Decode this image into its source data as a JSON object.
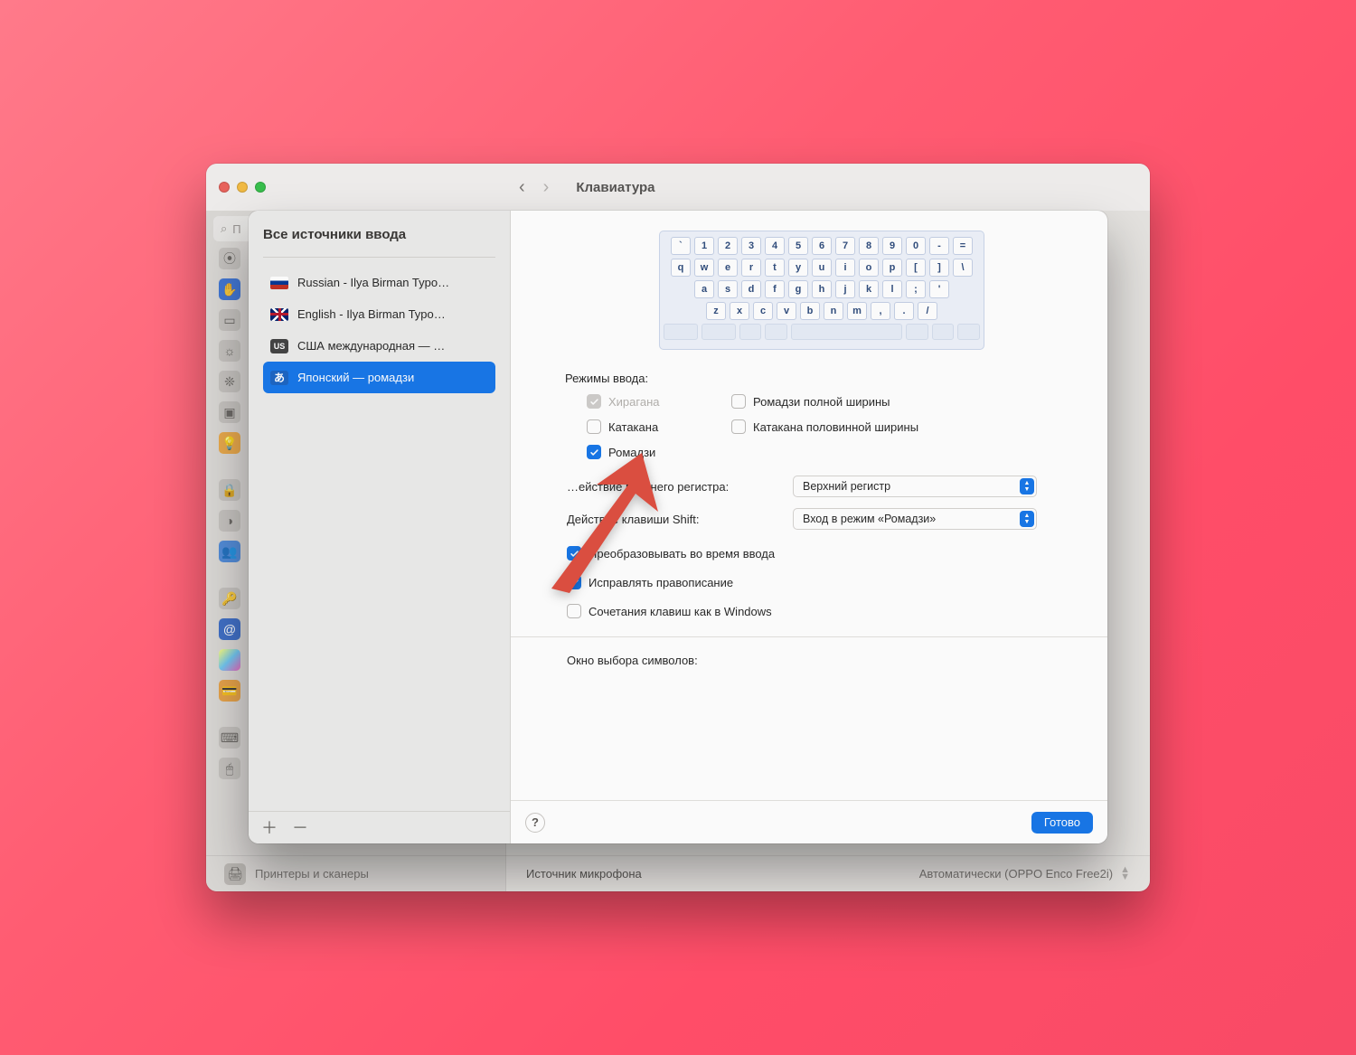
{
  "bg": {
    "title": "Клавиатура",
    "search_placeholder": "П",
    "printers": "Принтеры и сканеры",
    "mic_label": "Источник микрофона",
    "mic_value": "Автоматически (OPPO Enco Free2i)"
  },
  "sheet": {
    "sidebar_title": "Все источники ввода",
    "sources": [
      {
        "label": "Russian - Ilya Birman Typo…",
        "flag": "ru"
      },
      {
        "label": "English - Ilya Birman Typo…",
        "flag": "gb"
      },
      {
        "label": "США международная — …",
        "flag": "us",
        "flag_text": "US"
      },
      {
        "label": "Японский — ромадзи",
        "flag": "jp",
        "flag_text": "あ",
        "selected": true
      }
    ],
    "modes_label": "Режимы ввода:",
    "modes": {
      "hiragana": "Хирагана",
      "katakana": "Катакана",
      "romaji": "Ромадзи",
      "romaji_full": "Ромадзи полной ширины",
      "katakana_half": "Катакана половинной ширины"
    },
    "caps_label": "…ействие верхнего регистра:",
    "caps_value": "Верхний регистр",
    "shift_label": "Действие клавиши Shift:",
    "shift_value": "Вход в режим «Ромадзи»",
    "opt_convert": "Преобразовывать во время ввода",
    "opt_correct": "Исправлять правописание",
    "opt_windows": "Сочетания клавиш как в Windows",
    "symbols_label": "Окно выбора символов:",
    "help": "?",
    "done": "Готово"
  },
  "keyboard_rows": [
    [
      "`",
      "1",
      "2",
      "3",
      "4",
      "5",
      "6",
      "7",
      "8",
      "9",
      "0",
      "-",
      "="
    ],
    [
      "q",
      "w",
      "e",
      "r",
      "t",
      "y",
      "u",
      "i",
      "o",
      "p",
      "[",
      "]",
      "\\"
    ],
    [
      "a",
      "s",
      "d",
      "f",
      "g",
      "h",
      "j",
      "k",
      "l",
      ";",
      "'"
    ],
    [
      "z",
      "x",
      "c",
      "v",
      "b",
      "n",
      "m",
      ",",
      ".",
      "/"
    ]
  ]
}
